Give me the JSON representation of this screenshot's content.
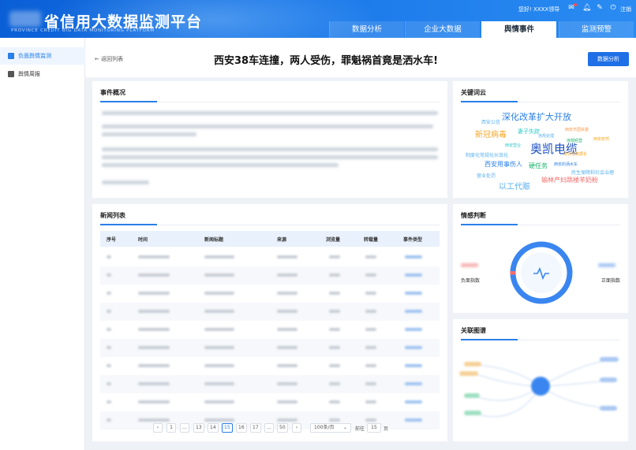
{
  "header": {
    "title": "省信用大数据监测平台",
    "subtitle": "PROVINCE CREDIT BIG DATA MONITORING PLATFORM",
    "greeting": "您好! XXXX领导",
    "logout": "注销",
    "tabs": [
      {
        "label": "数据分析",
        "active": false
      },
      {
        "label": "企业大数据",
        "active": false
      },
      {
        "label": "舆情事件",
        "active": true
      },
      {
        "label": "监测预警",
        "active": false
      }
    ]
  },
  "sidebar": {
    "items": [
      {
        "label": "负面舆情监测",
        "icon": "monitor-icon",
        "active": true
      },
      {
        "label": "舆情周报",
        "icon": "report-icon",
        "active": false
      }
    ]
  },
  "topbar": {
    "back_label": "返回列表",
    "event_title": "西安38车连撞，两人受伤，罪魁祸首竟是洒水车!",
    "analysis_button": "数据分析"
  },
  "overview": {
    "title": "事件概况"
  },
  "news": {
    "title": "新闻列表",
    "columns": [
      "序号",
      "时间",
      "新闻标题",
      "来源",
      "浏览量",
      "转载量",
      "事件类型"
    ],
    "row_count": 10
  },
  "pagination": {
    "pages": [
      "1",
      "...",
      "13",
      "14",
      "15",
      "16",
      "17",
      "...",
      "50"
    ],
    "current": "15",
    "prev": "‹",
    "next": "›",
    "page_size": "100条/页",
    "goto_label": "前往",
    "goto_value": "15",
    "page_unit": "页"
  },
  "keywords": {
    "title": "关键词云",
    "words": [
      {
        "text": "深化改革扩大开放",
        "color": "#2a7fe8"
      },
      {
        "text": "奥凯电缆",
        "color": "#1a4fc4"
      },
      {
        "text": "新冠病毒",
        "color": "#f5a623"
      },
      {
        "text": "妻子失踪",
        "color": "#2ec7c9"
      },
      {
        "text": "西安公信",
        "color": "#5ab1ef"
      },
      {
        "text": "西安市国资委",
        "color": "#f5994e"
      },
      {
        "text": "违规处理",
        "color": "#5ab1ef"
      },
      {
        "text": "违规经营",
        "color": "#19b36b"
      },
      {
        "text": "西安营业",
        "color": "#2ec7c9"
      },
      {
        "text": "制度化常规化长效化",
        "color": "#5ab1ef"
      },
      {
        "text": "营业处罚",
        "color": "#5ab1ef"
      },
      {
        "text": "统计全数据长",
        "color": "#f5a623"
      },
      {
        "text": "西安用事伤人",
        "color": "#2a7fe8"
      },
      {
        "text": "硬任务",
        "color": "#19b36b"
      },
      {
        "text": "西安的洒水车",
        "color": "#2a7fe8"
      },
      {
        "text": "民生保障和社会治理",
        "color": "#5ab1ef"
      },
      {
        "text": "西安安然",
        "color": "#f5a623"
      },
      {
        "text": "以工代赈",
        "color": "#5ab1ef"
      },
      {
        "text": "输林产妇跳楼羊奶粉",
        "color": "#f56c6c"
      }
    ]
  },
  "sentiment": {
    "title": "情感判断",
    "negative_label": "负面指数",
    "positive_label": "正面指数",
    "negative_share": 0.02,
    "positive_share": 0.98,
    "negative_color": "#f56c6c",
    "positive_color": "#3a86f0",
    "center_icon": "heartbeat-icon"
  },
  "relations": {
    "title": "关联图谱"
  }
}
